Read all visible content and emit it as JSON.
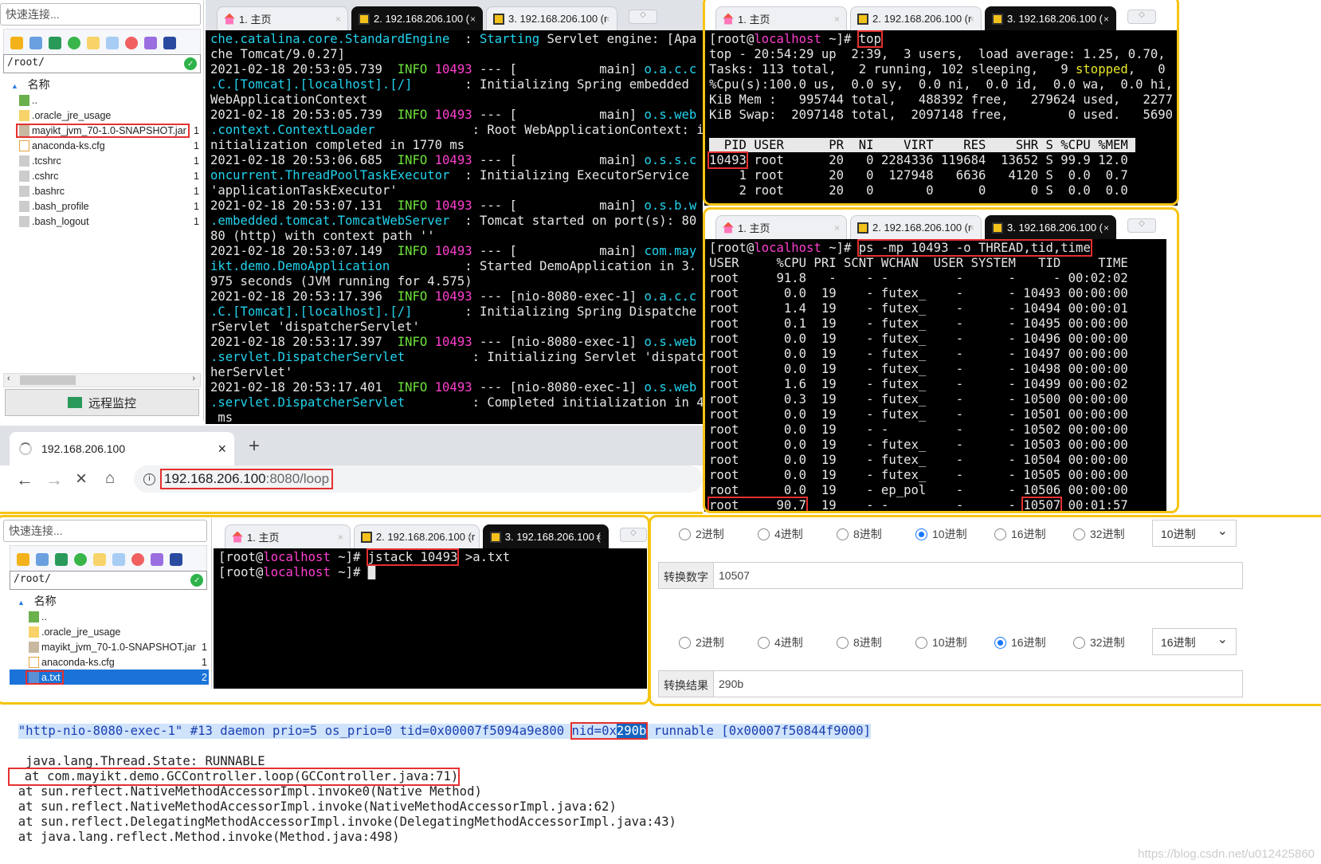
{
  "colors": {
    "accent_yellow": "#f6c413",
    "highlight_red": "#e53030",
    "term_cyan": "#22d3ee",
    "term_green": "#6ee33a",
    "term_magenta": "#ff3fd0"
  },
  "tabsets": {
    "main": {
      "tabs": [
        {
          "label": "1. 主页",
          "icon": "home-icon"
        },
        {
          "label": "2. 192.168.206.100 (",
          "icon": "key-icon"
        },
        {
          "label": "3. 192.168.206.100 (r",
          "icon": "key-icon"
        }
      ],
      "active": 1
    },
    "top": {
      "tabs": [
        {
          "label": "1. 主页",
          "icon": "home-icon"
        },
        {
          "label": "2. 192.168.206.100 (r",
          "icon": "key-icon"
        },
        {
          "label": "3. 192.168.206.100 (",
          "icon": "key-icon"
        }
      ],
      "active": 2
    },
    "ps": {
      "tabs": [
        {
          "label": "1. 主页",
          "icon": "home-icon"
        },
        {
          "label": "2. 192.168.206.100 (r",
          "icon": "key-icon"
        },
        {
          "label": "3. 192.168.206.100 (",
          "icon": "key-icon"
        }
      ],
      "active": 2
    },
    "jstack": {
      "tabs": [
        {
          "label": "1. 主页",
          "icon": "home-icon"
        },
        {
          "label": "2. 192.168.206.100 (r",
          "icon": "key-icon"
        },
        {
          "label": "3. 192.168.206.100 (",
          "icon": "key-icon"
        }
      ],
      "active": 2
    }
  },
  "sftp_top": {
    "quick_connect": "快速连接...",
    "path": "/root/",
    "col_name": "名称",
    "monitor_button": "远程监控",
    "files": [
      {
        "name": "..",
        "icon": "up",
        "size": ""
      },
      {
        "name": ".oracle_jre_usage",
        "icon": "folder",
        "size": ""
      },
      {
        "name": "mayikt_jvm_70-1.0-SNAPSHOT.jar",
        "icon": "jar",
        "size": "1",
        "boxed": true
      },
      {
        "name": "anaconda-ks.cfg",
        "icon": "doc",
        "size": "1"
      },
      {
        "name": ".tcshrc",
        "icon": "file",
        "size": "1"
      },
      {
        "name": ".cshrc",
        "icon": "file",
        "size": "1"
      },
      {
        "name": ".bashrc",
        "icon": "file",
        "size": "1"
      },
      {
        "name": ".bash_profile",
        "icon": "file",
        "size": "1"
      },
      {
        "name": ".bash_logout",
        "icon": "file",
        "size": "1"
      }
    ]
  },
  "sftp_bottom": {
    "quick_connect": "快速连接...",
    "path": "/root/",
    "col_name": "名称",
    "files": [
      {
        "name": "..",
        "icon": "up",
        "size": ""
      },
      {
        "name": ".oracle_jre_usage",
        "icon": "folder",
        "size": ""
      },
      {
        "name": "mayikt_jvm_70-1.0-SNAPSHOT.jar",
        "icon": "jar",
        "size": "1"
      },
      {
        "name": "anaconda-ks.cfg",
        "icon": "doc",
        "size": "1"
      },
      {
        "name": "a.txt",
        "icon": "txt",
        "size": "2",
        "boxed": true,
        "selected": true
      }
    ]
  },
  "terminals": {
    "main": [
      [
        [
          "che.catalina.core.StandardEngine",
          "c"
        ],
        [
          "  : ",
          "w"
        ],
        [
          "Starting",
          "c"
        ],
        [
          " Servlet engine: [Apa",
          "w"
        ]
      ],
      [
        [
          "che Tomcat/9.0.27]",
          "w"
        ]
      ],
      [
        [
          "2021-02-18 20:53:05.739",
          "w"
        ],
        [
          "  INFO ",
          "g"
        ],
        [
          "10493",
          "m"
        ],
        [
          " --- [           main] ",
          "w"
        ],
        [
          "o.a.c.c",
          "c"
        ]
      ],
      [
        [
          ".C.[Tomcat].[localhost].[/]",
          "c"
        ],
        [
          "       : Initializing Spring embedded",
          "w"
        ]
      ],
      [
        [
          "WebApplicationContext",
          "w"
        ]
      ],
      [
        [
          "2021-02-18 20:53:05.739",
          "w"
        ],
        [
          "  INFO ",
          "g"
        ],
        [
          "10493",
          "m"
        ],
        [
          " --- [           main] ",
          "w"
        ],
        [
          "o.s.web",
          "c"
        ]
      ],
      [
        [
          ".context.ContextLoader",
          "c"
        ],
        [
          "             : Root WebApplicationContext: i",
          "w"
        ]
      ],
      [
        [
          "nitialization completed in 1770 ms",
          "w"
        ]
      ],
      [
        [
          "2021-02-18 20:53:06.685",
          "w"
        ],
        [
          "  INFO ",
          "g"
        ],
        [
          "10493",
          "m"
        ],
        [
          " --- [           main] ",
          "w"
        ],
        [
          "o.s.s.c",
          "c"
        ]
      ],
      [
        [
          "oncurrent.ThreadPoolTaskExecutor",
          "c"
        ],
        [
          "  : Initializing ExecutorService",
          "w"
        ]
      ],
      [
        [
          "'applicationTaskExecutor'",
          "w"
        ]
      ],
      [
        [
          "2021-02-18 20:53:07.131",
          "w"
        ],
        [
          "  INFO ",
          "g"
        ],
        [
          "10493",
          "m"
        ],
        [
          " --- [           main] ",
          "w"
        ],
        [
          "o.s.b.w",
          "c"
        ]
      ],
      [
        [
          ".embedded.tomcat.TomcatWebServer",
          "c"
        ],
        [
          "  : Tomcat started on port(s): 80",
          "w"
        ]
      ],
      [
        [
          "80 (http) with context path ''",
          "w"
        ]
      ],
      [
        [
          "2021-02-18 20:53:07.149",
          "w"
        ],
        [
          "  INFO ",
          "g"
        ],
        [
          "10493",
          "m"
        ],
        [
          " --- [           main] ",
          "w"
        ],
        [
          "com.may",
          "c"
        ]
      ],
      [
        [
          "ikt.demo.DemoApplication",
          "c"
        ],
        [
          "          : Started DemoApplication in 3.",
          "w"
        ]
      ],
      [
        [
          "975 seconds (JVM running for 4.575)",
          "w"
        ]
      ],
      [
        [
          "2021-02-18 20:53:17.396",
          "w"
        ],
        [
          "  INFO ",
          "g"
        ],
        [
          "10493",
          "m"
        ],
        [
          " --- [nio-8080-exec-1] ",
          "w"
        ],
        [
          "o.a.c.c",
          "c"
        ]
      ],
      [
        [
          ".C.[Tomcat].[localhost].[/]",
          "c"
        ],
        [
          "       : Initializing Spring Dispatche",
          "w"
        ]
      ],
      [
        [
          "rServlet 'dispatcherServlet'",
          "w"
        ]
      ],
      [
        [
          "2021-02-18 20:53:17.397",
          "w"
        ],
        [
          "  INFO ",
          "g"
        ],
        [
          "10493",
          "m"
        ],
        [
          " --- [nio-8080-exec-1] ",
          "w"
        ],
        [
          "o.s.web",
          "c"
        ]
      ],
      [
        [
          ".servlet.DispatcherServlet",
          "c"
        ],
        [
          "         : Initializing Servlet 'dispatc",
          "w"
        ]
      ],
      [
        [
          "herServlet'",
          "w"
        ]
      ],
      [
        [
          "2021-02-18 20:53:17.401",
          "w"
        ],
        [
          "  INFO ",
          "g"
        ],
        [
          "10493",
          "m"
        ],
        [
          " --- [nio-8080-exec-1] ",
          "w"
        ],
        [
          "o.s.web",
          "c"
        ]
      ],
      [
        [
          ".servlet.DispatcherServlet",
          "c"
        ],
        [
          "         : Completed initialization in 4",
          "w"
        ]
      ],
      [
        [
          " ms",
          "w"
        ]
      ]
    ],
    "top": [
      [
        [
          "[root@",
          "w"
        ],
        [
          "localhost",
          "m"
        ],
        [
          " ~]# ",
          "w"
        ],
        [
          "top",
          "box"
        ]
      ],
      [
        [
          "top - 20:54:29 up  2:39,  3 users,  load average: 1.25, 0.70,",
          "w"
        ]
      ],
      [
        [
          "Tasks: 113 total,   2 running, 102 sleeping,   9 ",
          "w"
        ],
        [
          "stopped",
          "y"
        ],
        [
          ",   0",
          "w"
        ]
      ],
      [
        [
          "%Cpu(s):100.0 us,  0.0 sy,  0.0 ni,  0.0 id,  0.0 wa,  0.0 hi,",
          "w"
        ]
      ],
      [
        [
          "KiB Mem :   995744 total,   488392 free,   279624 used,   2277",
          "w"
        ]
      ],
      [
        [
          "KiB Swap:  2097148 total,  2097148 free,        0 used.   5690",
          "w"
        ]
      ],
      [
        [
          "",
          "w"
        ]
      ],
      [
        [
          "  PID USER      PR  NI    VIRT    RES    SHR S %CPU %MEM ",
          "inv"
        ]
      ],
      [
        [
          "10493",
          "box"
        ],
        [
          " root      20   0 2284336 119684  13652 S 99.9 12.0",
          "w"
        ]
      ],
      [
        [
          "    1 root      20   0  127948   6636   4120 S  0.0  0.7",
          "w"
        ]
      ],
      [
        [
          "    2 root      20   0       0      0      0 S  0.0  0.0",
          "w"
        ]
      ]
    ],
    "ps": [
      [
        [
          "[root@",
          "w"
        ],
        [
          "localhost",
          "m"
        ],
        [
          " ~]# ",
          "w"
        ],
        [
          "ps -mp 10493 -o THREAD,tid,time",
          "box"
        ]
      ],
      [
        [
          "USER     %CPU PRI SCNT WCHAN  USER SYSTEM   TID     TIME",
          "w"
        ]
      ],
      [
        [
          "root     91.8   -    - -         -      -     - 00:02:02",
          "w"
        ]
      ],
      [
        [
          "root      0.0  19    - futex_    -      - 10493 00:00:00",
          "w"
        ]
      ],
      [
        [
          "root      1.4  19    - futex_    -      - 10494 00:00:01",
          "w"
        ]
      ],
      [
        [
          "root      0.1  19    - futex_    -      - 10495 00:00:00",
          "w"
        ]
      ],
      [
        [
          "root      0.0  19    - futex_    -      - 10496 00:00:00",
          "w"
        ]
      ],
      [
        [
          "root      0.0  19    - futex_    -      - 10497 00:00:00",
          "w"
        ]
      ],
      [
        [
          "root      0.0  19    - futex_    -      - 10498 00:00:00",
          "w"
        ]
      ],
      [
        [
          "root      1.6  19    - futex_    -      - 10499 00:00:02",
          "w"
        ]
      ],
      [
        [
          "root      0.3  19    - futex_    -      - 10500 00:00:00",
          "w"
        ]
      ],
      [
        [
          "root      0.0  19    - futex_    -      - 10501 00:00:00",
          "w"
        ]
      ],
      [
        [
          "root      0.0  19    - -         -      - 10502 00:00:00",
          "w"
        ]
      ],
      [
        [
          "root      0.0  19    - futex_    -      - 10503 00:00:00",
          "w"
        ]
      ],
      [
        [
          "root      0.0  19    - futex_    -      - 10504 00:00:00",
          "w"
        ]
      ],
      [
        [
          "root      0.0  19    - futex_    -      - 10505 00:00:00",
          "w"
        ]
      ],
      [
        [
          "root      0.0  19    - ep_pol    -      - 10506 00:00:00",
          "w"
        ]
      ],
      [
        [
          "root     90.7",
          "box"
        ],
        [
          "  19    - -         -      - ",
          "w"
        ],
        [
          "10507",
          "box"
        ],
        [
          " 00:01:57",
          "w"
        ]
      ]
    ],
    "jstack": [
      [
        [
          "[root@",
          "w"
        ],
        [
          "localhost",
          "m"
        ],
        [
          " ~]# ",
          "w"
        ],
        [
          "jstack 10493",
          "box"
        ],
        [
          " >a.txt",
          "w"
        ]
      ],
      [
        [
          "[root@",
          "w"
        ],
        [
          "localhost",
          "m"
        ],
        [
          " ~]# ",
          "w"
        ],
        [
          "█",
          "w"
        ]
      ]
    ]
  },
  "browser": {
    "tab_title": "192.168.206.100",
    "url_host": "192.168.206.100",
    "url_rest": ":8080/loop"
  },
  "converter": {
    "bases": [
      "2进制",
      "4进制",
      "8进制",
      "10进制",
      "16进制",
      "32进制"
    ],
    "input_selected": "10进制",
    "input_select_value": "10进制",
    "input_label": "转换数字",
    "input_value": "10507",
    "output_selected": "16进制",
    "output_select_value": "16进制",
    "output_label": "转换结果",
    "output_value": "290b"
  },
  "thread_dump": {
    "line1_pre": "\"http-nio-8080-exec-1\" #13 daemon prio=5 os_prio=0 tid=0x00007f5094a9e800 ",
    "line1_nid_prefix": "nid=0x",
    "line1_nid": "290b",
    "line1_post": " runnable [0x00007f50844f9000]",
    "lines": [
      "   java.lang.Thread.State: RUNNABLE",
      "  at com.mayikt.demo.GCController.loop(GCController.java:71)",
      "  at sun.reflect.NativeMethodAccessorImpl.invoke0(Native Method)",
      "  at sun.reflect.NativeMethodAccessorImpl.invoke(NativeMethodAccessorImpl.java:62)",
      "  at sun.reflect.DelegatingMethodAccessorImpl.invoke(DelegatingMethodAccessorImpl.java:43)",
      "  at java.lang.reflect.Method.invoke(Method.java:498)"
    ]
  },
  "watermark": "https://blog.csdn.net/u012425860"
}
